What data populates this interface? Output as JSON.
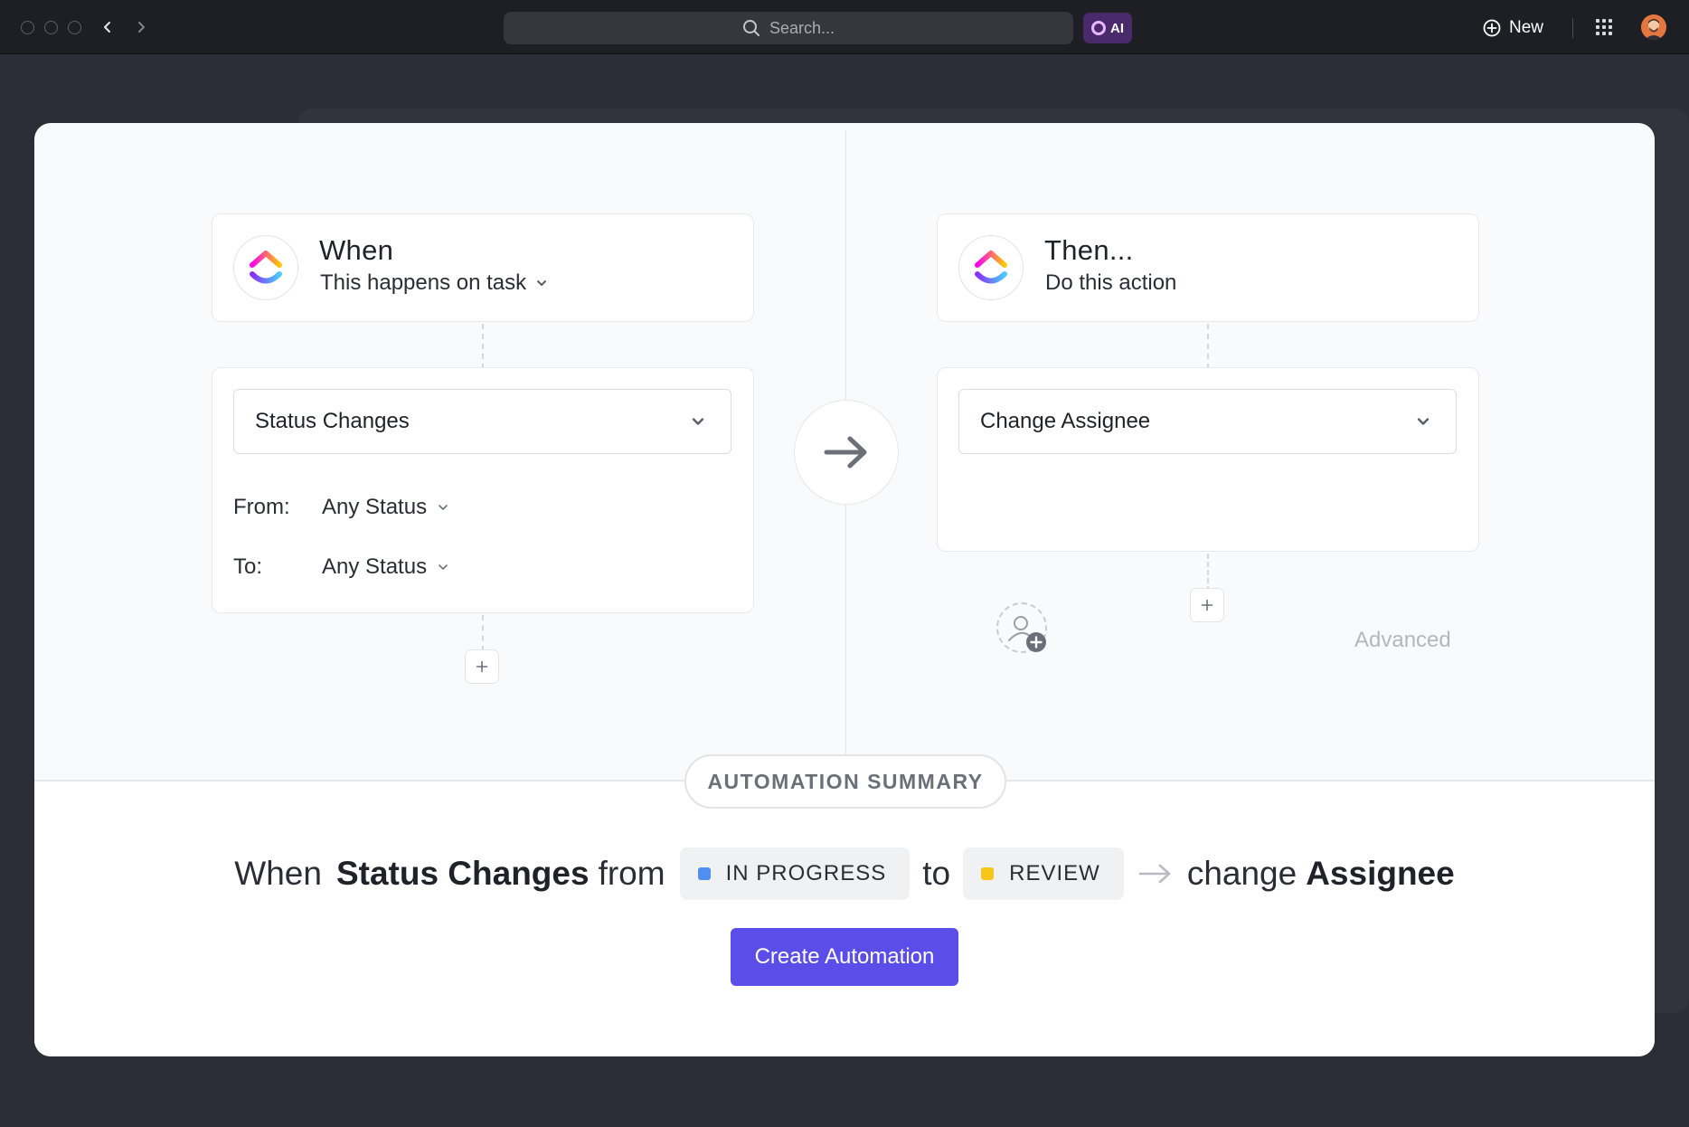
{
  "topbar": {
    "search_placeholder": "Search...",
    "ai_label": "AI",
    "new_label": "New"
  },
  "trigger": {
    "title": "When",
    "subtitle": "This happens on task",
    "selected_trigger": "Status Changes",
    "from_label": "From:",
    "from_value": "Any Status",
    "to_label": "To:",
    "to_value": "Any Status"
  },
  "action": {
    "title": "Then...",
    "subtitle": "Do this action",
    "selected_action": "Change Assignee",
    "advanced_label": "Advanced"
  },
  "summary": {
    "heading": "AUTOMATION SUMMARY",
    "when": "When",
    "trigger": "Status Changes",
    "from_word": "from",
    "from_status": "IN PROGRESS",
    "from_color": "#4f8ff0",
    "to_word": "to",
    "to_status": "REVIEW",
    "to_color": "#f6c518",
    "action_verb": "change",
    "action_target": "Assignee"
  },
  "create_button_label": "Create Automation",
  "colors": {
    "accent": "#5b4de8"
  }
}
